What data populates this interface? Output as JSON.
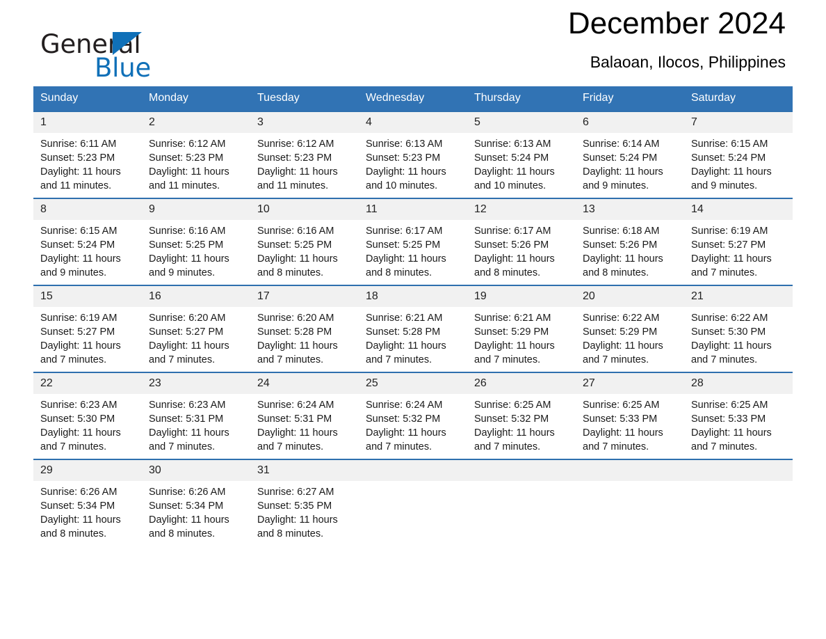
{
  "brand": {
    "name_part1": "General",
    "name_part2": "Blue",
    "triangle_icon": "blue-triangle-icon",
    "accent_color": "#1070b8"
  },
  "header": {
    "month_title": "December 2024",
    "location": "Balaoan, Ilocos, Philippines",
    "header_bg_color": "#3173b4",
    "row_border_color": "#2e6fae",
    "daynum_bg_color": "#f1f1f1"
  },
  "weekday_headers": [
    "Sunday",
    "Monday",
    "Tuesday",
    "Wednesday",
    "Thursday",
    "Friday",
    "Saturday"
  ],
  "labels": {
    "sunrise_prefix": "Sunrise:",
    "sunset_prefix": "Sunset:",
    "daylight_prefix": "Daylight:"
  },
  "weeks": [
    [
      {
        "day": "1",
        "sunrise": "Sunrise: 6:11 AM",
        "sunset": "Sunset: 5:23 PM",
        "daylight_line1": "Daylight: 11 hours",
        "daylight_line2": "and 11 minutes."
      },
      {
        "day": "2",
        "sunrise": "Sunrise: 6:12 AM",
        "sunset": "Sunset: 5:23 PM",
        "daylight_line1": "Daylight: 11 hours",
        "daylight_line2": "and 11 minutes."
      },
      {
        "day": "3",
        "sunrise": "Sunrise: 6:12 AM",
        "sunset": "Sunset: 5:23 PM",
        "daylight_line1": "Daylight: 11 hours",
        "daylight_line2": "and 11 minutes."
      },
      {
        "day": "4",
        "sunrise": "Sunrise: 6:13 AM",
        "sunset": "Sunset: 5:23 PM",
        "daylight_line1": "Daylight: 11 hours",
        "daylight_line2": "and 10 minutes."
      },
      {
        "day": "5",
        "sunrise": "Sunrise: 6:13 AM",
        "sunset": "Sunset: 5:24 PM",
        "daylight_line1": "Daylight: 11 hours",
        "daylight_line2": "and 10 minutes."
      },
      {
        "day": "6",
        "sunrise": "Sunrise: 6:14 AM",
        "sunset": "Sunset: 5:24 PM",
        "daylight_line1": "Daylight: 11 hours",
        "daylight_line2": "and 9 minutes."
      },
      {
        "day": "7",
        "sunrise": "Sunrise: 6:15 AM",
        "sunset": "Sunset: 5:24 PM",
        "daylight_line1": "Daylight: 11 hours",
        "daylight_line2": "and 9 minutes."
      }
    ],
    [
      {
        "day": "8",
        "sunrise": "Sunrise: 6:15 AM",
        "sunset": "Sunset: 5:24 PM",
        "daylight_line1": "Daylight: 11 hours",
        "daylight_line2": "and 9 minutes."
      },
      {
        "day": "9",
        "sunrise": "Sunrise: 6:16 AM",
        "sunset": "Sunset: 5:25 PM",
        "daylight_line1": "Daylight: 11 hours",
        "daylight_line2": "and 9 minutes."
      },
      {
        "day": "10",
        "sunrise": "Sunrise: 6:16 AM",
        "sunset": "Sunset: 5:25 PM",
        "daylight_line1": "Daylight: 11 hours",
        "daylight_line2": "and 8 minutes."
      },
      {
        "day": "11",
        "sunrise": "Sunrise: 6:17 AM",
        "sunset": "Sunset: 5:25 PM",
        "daylight_line1": "Daylight: 11 hours",
        "daylight_line2": "and 8 minutes."
      },
      {
        "day": "12",
        "sunrise": "Sunrise: 6:17 AM",
        "sunset": "Sunset: 5:26 PM",
        "daylight_line1": "Daylight: 11 hours",
        "daylight_line2": "and 8 minutes."
      },
      {
        "day": "13",
        "sunrise": "Sunrise: 6:18 AM",
        "sunset": "Sunset: 5:26 PM",
        "daylight_line1": "Daylight: 11 hours",
        "daylight_line2": "and 8 minutes."
      },
      {
        "day": "14",
        "sunrise": "Sunrise: 6:19 AM",
        "sunset": "Sunset: 5:27 PM",
        "daylight_line1": "Daylight: 11 hours",
        "daylight_line2": "and 7 minutes."
      }
    ],
    [
      {
        "day": "15",
        "sunrise": "Sunrise: 6:19 AM",
        "sunset": "Sunset: 5:27 PM",
        "daylight_line1": "Daylight: 11 hours",
        "daylight_line2": "and 7 minutes."
      },
      {
        "day": "16",
        "sunrise": "Sunrise: 6:20 AM",
        "sunset": "Sunset: 5:27 PM",
        "daylight_line1": "Daylight: 11 hours",
        "daylight_line2": "and 7 minutes."
      },
      {
        "day": "17",
        "sunrise": "Sunrise: 6:20 AM",
        "sunset": "Sunset: 5:28 PM",
        "daylight_line1": "Daylight: 11 hours",
        "daylight_line2": "and 7 minutes."
      },
      {
        "day": "18",
        "sunrise": "Sunrise: 6:21 AM",
        "sunset": "Sunset: 5:28 PM",
        "daylight_line1": "Daylight: 11 hours",
        "daylight_line2": "and 7 minutes."
      },
      {
        "day": "19",
        "sunrise": "Sunrise: 6:21 AM",
        "sunset": "Sunset: 5:29 PM",
        "daylight_line1": "Daylight: 11 hours",
        "daylight_line2": "and 7 minutes."
      },
      {
        "day": "20",
        "sunrise": "Sunrise: 6:22 AM",
        "sunset": "Sunset: 5:29 PM",
        "daylight_line1": "Daylight: 11 hours",
        "daylight_line2": "and 7 minutes."
      },
      {
        "day": "21",
        "sunrise": "Sunrise: 6:22 AM",
        "sunset": "Sunset: 5:30 PM",
        "daylight_line1": "Daylight: 11 hours",
        "daylight_line2": "and 7 minutes."
      }
    ],
    [
      {
        "day": "22",
        "sunrise": "Sunrise: 6:23 AM",
        "sunset": "Sunset: 5:30 PM",
        "daylight_line1": "Daylight: 11 hours",
        "daylight_line2": "and 7 minutes."
      },
      {
        "day": "23",
        "sunrise": "Sunrise: 6:23 AM",
        "sunset": "Sunset: 5:31 PM",
        "daylight_line1": "Daylight: 11 hours",
        "daylight_line2": "and 7 minutes."
      },
      {
        "day": "24",
        "sunrise": "Sunrise: 6:24 AM",
        "sunset": "Sunset: 5:31 PM",
        "daylight_line1": "Daylight: 11 hours",
        "daylight_line2": "and 7 minutes."
      },
      {
        "day": "25",
        "sunrise": "Sunrise: 6:24 AM",
        "sunset": "Sunset: 5:32 PM",
        "daylight_line1": "Daylight: 11 hours",
        "daylight_line2": "and 7 minutes."
      },
      {
        "day": "26",
        "sunrise": "Sunrise: 6:25 AM",
        "sunset": "Sunset: 5:32 PM",
        "daylight_line1": "Daylight: 11 hours",
        "daylight_line2": "and 7 minutes."
      },
      {
        "day": "27",
        "sunrise": "Sunrise: 6:25 AM",
        "sunset": "Sunset: 5:33 PM",
        "daylight_line1": "Daylight: 11 hours",
        "daylight_line2": "and 7 minutes."
      },
      {
        "day": "28",
        "sunrise": "Sunrise: 6:25 AM",
        "sunset": "Sunset: 5:33 PM",
        "daylight_line1": "Daylight: 11 hours",
        "daylight_line2": "and 7 minutes."
      }
    ],
    [
      {
        "day": "29",
        "sunrise": "Sunrise: 6:26 AM",
        "sunset": "Sunset: 5:34 PM",
        "daylight_line1": "Daylight: 11 hours",
        "daylight_line2": "and 8 minutes."
      },
      {
        "day": "30",
        "sunrise": "Sunrise: 6:26 AM",
        "sunset": "Sunset: 5:34 PM",
        "daylight_line1": "Daylight: 11 hours",
        "daylight_line2": "and 8 minutes."
      },
      {
        "day": "31",
        "sunrise": "Sunrise: 6:27 AM",
        "sunset": "Sunset: 5:35 PM",
        "daylight_line1": "Daylight: 11 hours",
        "daylight_line2": "and 8 minutes."
      },
      {
        "day": "",
        "sunrise": "",
        "sunset": "",
        "daylight_line1": "",
        "daylight_line2": ""
      },
      {
        "day": "",
        "sunrise": "",
        "sunset": "",
        "daylight_line1": "",
        "daylight_line2": ""
      },
      {
        "day": "",
        "sunrise": "",
        "sunset": "",
        "daylight_line1": "",
        "daylight_line2": ""
      },
      {
        "day": "",
        "sunrise": "",
        "sunset": "",
        "daylight_line1": "",
        "daylight_line2": ""
      }
    ]
  ]
}
